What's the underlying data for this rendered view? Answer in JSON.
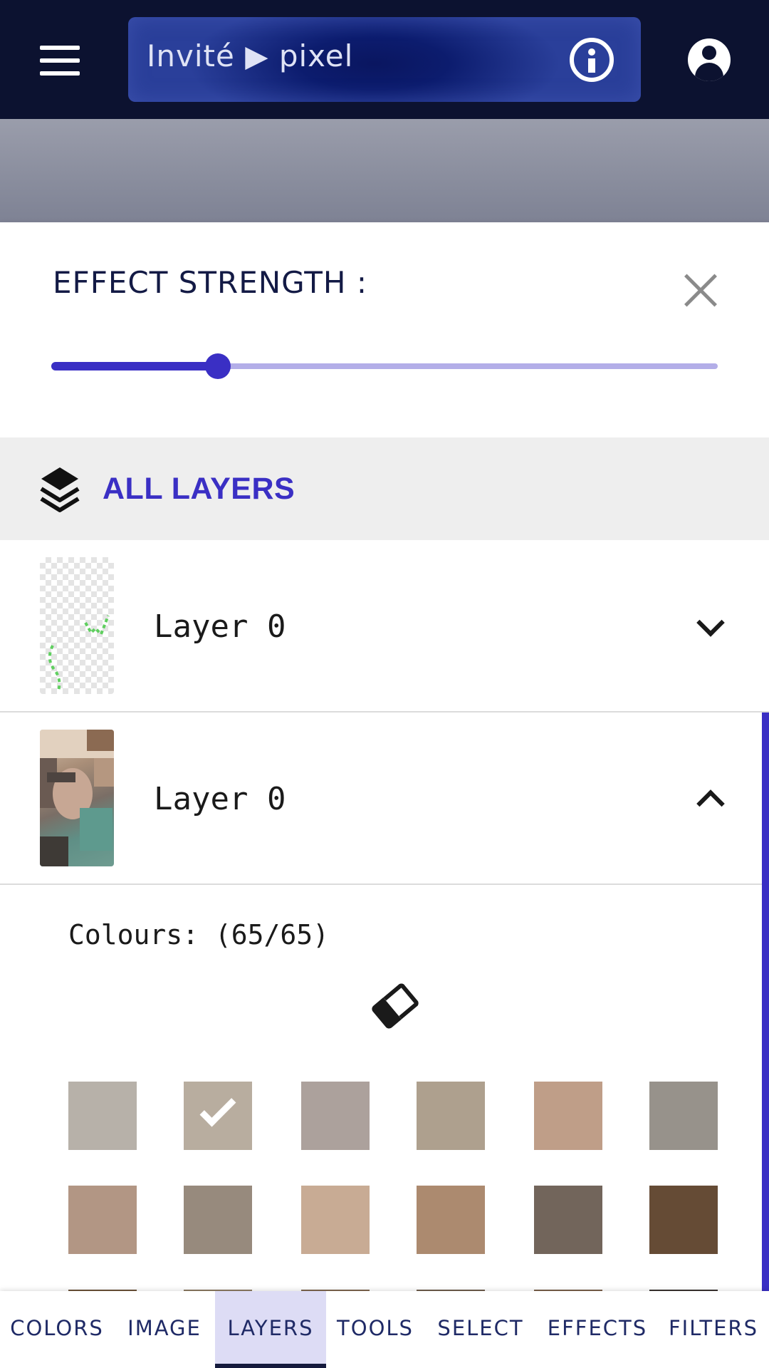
{
  "header": {
    "menu_icon": "hamburger-menu-icon",
    "breadcrumb": "Invité ▶ pixel",
    "info_icon": "info-icon",
    "account_icon": "account-circle-icon"
  },
  "effect_panel": {
    "title": "EFFECT STRENGTH :",
    "close_icon": "close-icon",
    "slider_value_fraction": 0.25
  },
  "layers_header": {
    "icon": "layers-icon",
    "label": "ALL LAYERS"
  },
  "layers": [
    {
      "name": "Layer 0",
      "expanded": false,
      "chevron_icon": "chevron-down-icon"
    },
    {
      "name": "Layer 0",
      "expanded": true,
      "chevron_icon": "chevron-up-icon"
    }
  ],
  "palette": {
    "colours_label": "Colours: (65/65)",
    "eraser_icon": "eraser-icon",
    "swatches": [
      {
        "color": "#b7b1a9",
        "selected": false
      },
      {
        "color": "#b8ad9f",
        "selected": true
      },
      {
        "color": "#aca19c",
        "selected": false
      },
      {
        "color": "#aea08e",
        "selected": false
      },
      {
        "color": "#bf9e88",
        "selected": false
      },
      {
        "color": "#97928b",
        "selected": false
      },
      {
        "color": "#b29684",
        "selected": false
      },
      {
        "color": "#978a7d",
        "selected": false
      },
      {
        "color": "#c8ab94",
        "selected": false
      },
      {
        "color": "#ac8a6f",
        "selected": false
      },
      {
        "color": "#72655b",
        "selected": false
      },
      {
        "color": "#654b35",
        "selected": false
      },
      {
        "color": "#6b5339",
        "selected": false
      },
      {
        "color": "#8d7a63",
        "selected": false
      },
      {
        "color": "#7e6750",
        "selected": false
      },
      {
        "color": "#6f5e4d",
        "selected": false
      },
      {
        "color": "#7a604a",
        "selected": false
      },
      {
        "color": "#3a3430",
        "selected": false
      }
    ]
  },
  "tabs": [
    {
      "label": "COLORS",
      "active": false
    },
    {
      "label": "IMAGE",
      "active": false
    },
    {
      "label": "LAYERS",
      "active": true
    },
    {
      "label": "TOOLS",
      "active": false
    },
    {
      "label": "SELECT",
      "active": false
    },
    {
      "label": "EFFECTS",
      "active": false
    },
    {
      "label": "FILTERS",
      "active": false
    }
  ],
  "colors": {
    "header_bg": "#0c1230",
    "accent": "#3a2fc4",
    "slider_track": "#b3aee8",
    "active_tab_bg": "#dddcf5"
  }
}
